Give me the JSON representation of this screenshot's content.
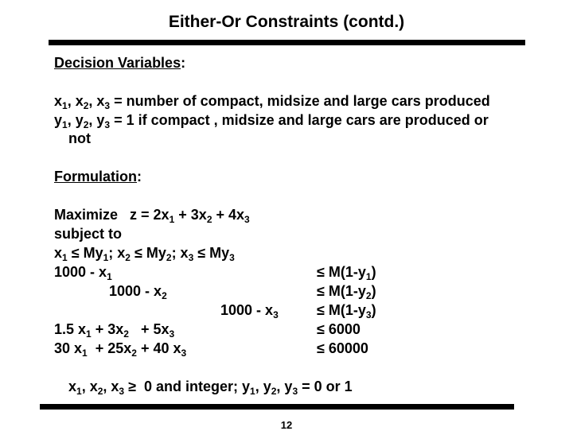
{
  "slide": {
    "title": "Either-Or Constraints (contd.)",
    "page_number": "12"
  },
  "decision_variables": {
    "heading": "Decision Variables",
    "heading_suffix": ":",
    "x_vars": [
      "x",
      "1",
      ", x",
      "2",
      ", x",
      "3"
    ],
    "x_desc": " = number of compact, midsize and large cars produced",
    "y_vars": [
      "y",
      "1",
      ", y",
      "2",
      ", y",
      "3"
    ],
    "y_desc": " = 1 if compact , midsize and large cars are produced or",
    "y_desc_cont": "not"
  },
  "formulation": {
    "heading": "Formulation",
    "heading_suffix": ":",
    "objective": {
      "prefix": "Maximize   z = 2x",
      "s1": "1",
      "p2": " + 3x",
      "s2": "2",
      "p3": " + 4x",
      "s3": "3"
    },
    "subject_to": "subject to",
    "linking": {
      "a": "x",
      "a_s": "1",
      "b": " ≤ My",
      "b_s": "1",
      "c": "; x",
      "c_s": "2",
      "d": " ≤ My",
      "d_s": "2",
      "e": "; x",
      "e_s": "3",
      "f": " ≤ My",
      "f_s": "3"
    },
    "either_or": [
      {
        "lhs": "1000 - x",
        "lhs_sub": "1",
        "rhs": "≤ M(1-y",
        "rhs_sub": "1",
        "rhs_end": ")"
      },
      {
        "lhs": "1000 - x",
        "lhs_sub": "2",
        "rhs": "≤ M(1-y",
        "rhs_sub": "2",
        "rhs_end": ")"
      },
      {
        "lhs": "1000 - x",
        "lhs_sub": "3",
        "rhs": "≤ M(1-y",
        "rhs_sub": "3",
        "rhs_end": ")"
      }
    ],
    "resource1": {
      "t1": "1.5 x",
      "s1": "1",
      "t2": " + 3x",
      "s2": "2",
      "t3": "   + 5x",
      "s3": "3",
      "rhs": "≤ 6000"
    },
    "resource2": {
      "t1": "30 x",
      "s1": "1",
      "t2": "  + 25x",
      "s2": "2",
      "t3": " + 40 x",
      "s3": "3",
      "rhs": "≤ 60000"
    },
    "domain": {
      "t1": "x",
      "s1": "1",
      "t2": ", x",
      "s2": "2",
      "t3": ", x",
      "s3": "3",
      "t4": " ≥  0 and integer; y",
      "s4": "1",
      "t5": ", y",
      "s5": "2",
      "t6": ", y",
      "s6": "3",
      "t7": " = 0 or 1"
    }
  }
}
